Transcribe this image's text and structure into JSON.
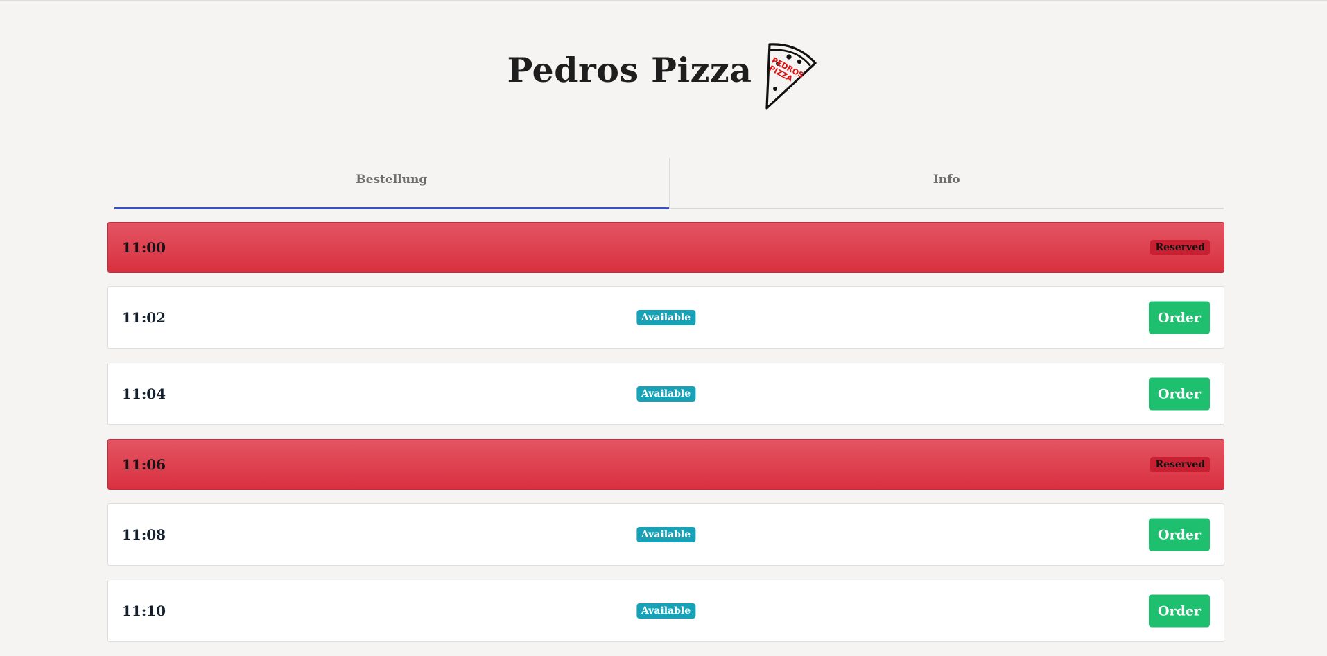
{
  "brand": {
    "title": "Pedros Pizza",
    "logo_text_line1": "PEDROS",
    "logo_text_line2": "PIZZA"
  },
  "tabs": [
    {
      "label": "Bestellung",
      "active": true
    },
    {
      "label": "Info",
      "active": false
    }
  ],
  "slots": [
    {
      "time": "11:00",
      "status": "Reserved"
    },
    {
      "time": "11:02",
      "status": "Available",
      "action": "Order"
    },
    {
      "time": "11:04",
      "status": "Available",
      "action": "Order"
    },
    {
      "time": "11:06",
      "status": "Reserved"
    },
    {
      "time": "11:08",
      "status": "Available",
      "action": "Order"
    },
    {
      "time": "11:10",
      "status": "Available",
      "action": "Order"
    }
  ],
  "colors": {
    "reserved": "#dc3545",
    "available_badge": "#17a2b8",
    "order_button": "#1fbf70",
    "active_tab_underline": "#3b4fc4",
    "logo_text": "#e01010"
  }
}
